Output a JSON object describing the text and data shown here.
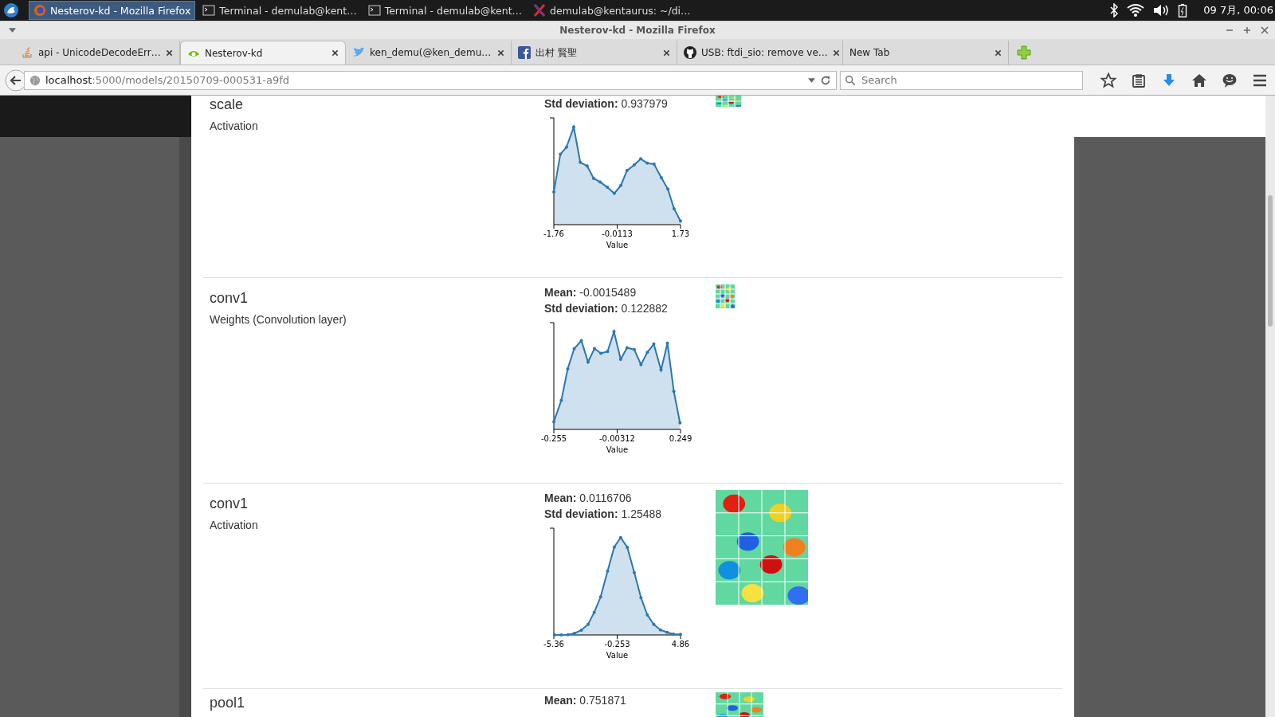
{
  "taskbar": {
    "windows": [
      {
        "title": "Nesterov-kd - Mozilla Firefox",
        "selected": true,
        "kind": "browser"
      },
      {
        "title": "Terminal - demulab@kent…",
        "selected": false,
        "kind": "terminal"
      },
      {
        "title": "Terminal - demulab@kent…",
        "selected": false,
        "kind": "terminal"
      },
      {
        "title": "demulab@kentaurus: ~/di…",
        "selected": false,
        "kind": "x"
      }
    ],
    "clock": "09  7月, 00:06"
  },
  "window": {
    "title": "Nesterov-kd - Mozilla Firefox"
  },
  "tabs": [
    {
      "label": "api - UnicodeDecodeErr…",
      "selected": false
    },
    {
      "label": "Nesterov-kd",
      "selected": true
    },
    {
      "label": "ken_demu(@ken_demu…",
      "selected": false
    },
    {
      "label": "出村 賢聖",
      "selected": false
    },
    {
      "label": "USB: ftdi_sio: remove ve…",
      "selected": false
    },
    {
      "label": "New Tab",
      "selected": false
    }
  ],
  "url": {
    "host": "localhost",
    "path": ":5000/models/20150709-000531-a9fd"
  },
  "search": {
    "placeholder": "Search"
  },
  "layers": [
    {
      "name": "scale",
      "type": "Activation",
      "std_label": "Std deviation:",
      "std": "0.937979",
      "ticks": [
        "-1.76",
        "-0.0113",
        "1.73"
      ],
      "xlabel": "Value"
    },
    {
      "name": "conv1",
      "type": "Weights (Convolution layer)",
      "mean_label": "Mean:",
      "mean": "-0.0015489",
      "std_label": "Std deviation:",
      "std": "0.122882",
      "ticks": [
        "-0.255",
        "-0.00312",
        "0.249"
      ],
      "xlabel": "Value"
    },
    {
      "name": "conv1",
      "type": "Activation",
      "mean_label": "Mean:",
      "mean": "0.0116706",
      "std_label": "Std deviation:",
      "std": "1.25488",
      "ticks": [
        "-5.36",
        "-0.253",
        "4.86"
      ],
      "xlabel": "Value"
    },
    {
      "name": "pool1",
      "mean_label": "Mean:",
      "mean": "0.751871"
    }
  ]
}
